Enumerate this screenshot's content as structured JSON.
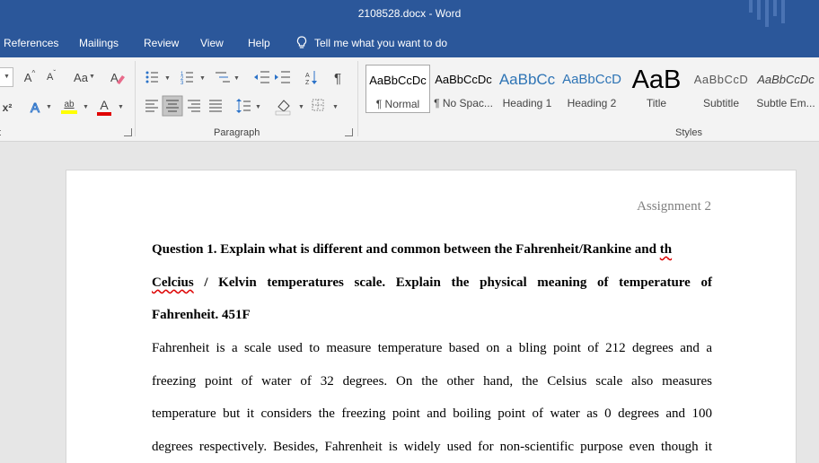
{
  "window": {
    "title": "2108528.docx  -  Word"
  },
  "menu": {
    "tabs": [
      "References",
      "Mailings",
      "Review",
      "View",
      "Help"
    ],
    "tell_me": "Tell me what you want to do"
  },
  "ribbon": {
    "font_group_label": "t",
    "paragraph_group_label": "Paragraph",
    "styles_group_label": "Styles",
    "change_case": "Aa",
    "superscript": "x²",
    "grow_font": "A",
    "shrink_font": "A",
    "text_effects": "A",
    "highlight": "ab",
    "font_color": "A",
    "highlight_color": "#ffff00",
    "font_color_bar": "#e00000",
    "styles": [
      {
        "preview": "AaBbCcDc",
        "label": "¶ Normal"
      },
      {
        "preview": "AaBbCcDc",
        "label": "¶ No Spac..."
      },
      {
        "preview": "AaBbCc",
        "label": "Heading 1"
      },
      {
        "preview": "AaBbCcD",
        "label": "Heading 2"
      },
      {
        "preview": "AaB",
        "label": "Title"
      },
      {
        "preview": "AaBbCcD",
        "label": "Subtitle"
      },
      {
        "preview": "AaBbCcDc",
        "label": "Subtle Em..."
      }
    ]
  },
  "document": {
    "header": "Assignment 2",
    "question": {
      "line1_a": "Question 1.  Explain what is different and common between the Fahrenheit/Rankine and ",
      "line1_b": "th",
      "line2_a": "Celcius",
      "line2_b": " / Kelvin temperatures scale. Explain the physical meaning of temperature of",
      "line3": "Fahrenheit. 451F"
    },
    "body": [
      "Fahrenheit is a scale used to measure temperature based on a bling point of 212 degrees and a",
      "freezing point of water of 32 degrees. On the other hand, the Celsius scale also measures",
      "temperature but it considers the freezing point and boiling point of water as 0 degrees and 100",
      "degrees respectively. Besides, Fahrenheit is widely used for non-scientific purpose even though it"
    ]
  }
}
